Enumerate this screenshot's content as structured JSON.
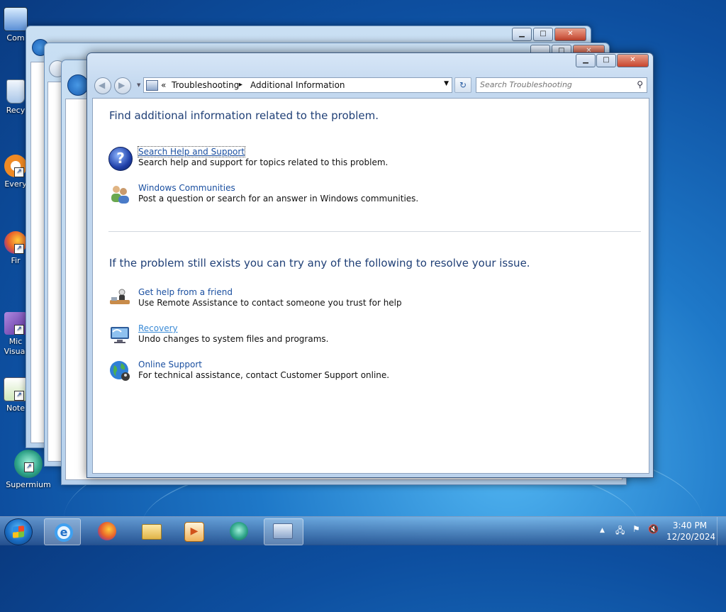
{
  "desktop": {
    "icons": [
      {
        "label": "Com",
        "color": "#5a8fd6"
      },
      {
        "label": "Recy",
        "color": "#a9c6e8"
      },
      {
        "label": "Every",
        "color": "#f08a24"
      },
      {
        "label": "Fir",
        "color": "#e8622a"
      },
      {
        "label": "Mic Visual",
        "color": "#7b4fb8"
      },
      {
        "label": "Note",
        "color": "#6db33f"
      },
      {
        "label": "Supermium",
        "color": "#2fa58a"
      }
    ]
  },
  "window": {
    "minimize": "▁",
    "maximize": "□",
    "close": "✕",
    "address": {
      "overflow": "«",
      "crumb1": "Troubleshooting",
      "sep": "▸",
      "crumb2": "Additional Information",
      "dropdown": "▼"
    },
    "refresh": "↻",
    "search_placeholder": "Search Troubleshooting",
    "content": {
      "heading1": "Find additional information related to the problem.",
      "tasks_top": [
        {
          "title": "Search Help and Support",
          "desc": "Search help and support for topics related to this problem.",
          "icon": "help-icon"
        },
        {
          "title": "Windows Communities",
          "desc": "Post a question or search for an answer in Windows communities.",
          "icon": "communities-icon"
        }
      ],
      "heading2": "If the problem still exists you can try any of the following to resolve your issue.",
      "tasks_bottom": [
        {
          "title": "Get help from a friend",
          "desc": "Use Remote Assistance to contact someone you trust for help",
          "icon": "remote-assistance-icon"
        },
        {
          "title": "Recovery",
          "desc": "Undo changes to system files and programs.",
          "icon": "recovery-icon"
        },
        {
          "title": "Online Support",
          "desc": "For technical assistance, contact Customer Support online.",
          "icon": "globe-icon"
        }
      ]
    }
  },
  "taskbar": {
    "time": "3:40 PM",
    "date": "12/20/2024",
    "tray_arrow": "▲"
  },
  "colors": {
    "link": "#1a4fa0",
    "heading": "#1f3f76"
  }
}
